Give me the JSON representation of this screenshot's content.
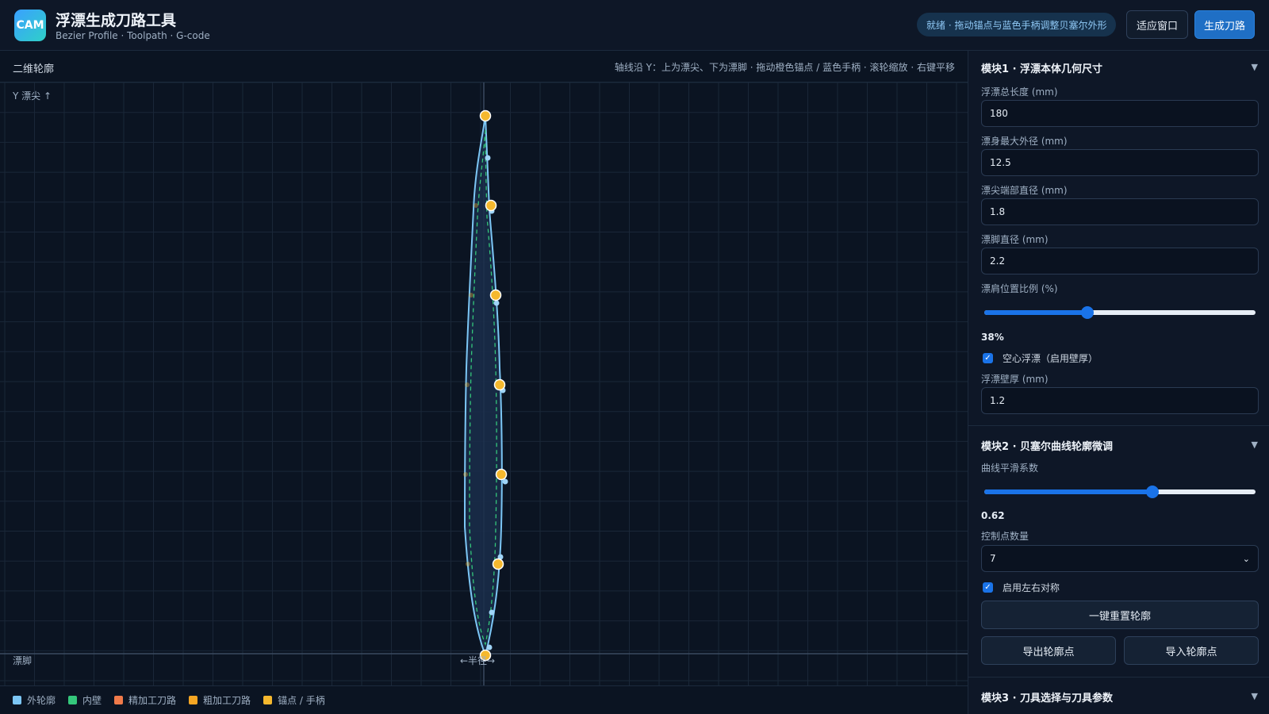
{
  "header": {
    "logo": "CAM",
    "title": "浮漂生成刀路工具",
    "subtitle": "Bezier Profile · Toolpath · G-code",
    "status": "就绪 · 拖动锚点与蓝色手柄调整贝塞尔外形",
    "fit_button": "适应窗口",
    "generate_button": "生成刀路"
  },
  "canvas": {
    "title": "二维轮廓",
    "hint": "轴线沿 Y：上为漂尖、下为漂脚 · 拖动橙色锚点 / 蓝色手柄 · 滚轮缩放 · 右键平移",
    "label_top": "Y 漂尖 ↑",
    "label_bottom": "漂脚",
    "label_radius": "←半径→"
  },
  "legend": [
    {
      "label": "外轮廓",
      "color": "#7cc6f5"
    },
    {
      "label": "内壁",
      "color": "#34c77b"
    },
    {
      "label": "精加工刀路",
      "color": "#f07a4a"
    },
    {
      "label": "粗加工刀路",
      "color": "#f5a623"
    },
    {
      "label": "锚点 / 手柄",
      "color": "#f5b82e"
    }
  ],
  "colors": {
    "outer_profile": "#7cc6f5",
    "inner_wall": "#34c77b",
    "anchor": "#f5b82e",
    "handle": "#9fd4f7",
    "accent": "#1f6fc5"
  },
  "module1": {
    "title": "模块1 · 浮漂本体几何尺寸",
    "length_label": "浮漂总长度 (mm)",
    "length_value": "180",
    "max_dia_label": "漂身最大外径 (mm)",
    "max_dia_value": "12.5",
    "tip_dia_label": "漂尖端部直径 (mm)",
    "tip_dia_value": "1.8",
    "foot_dia_label": "漂脚直径 (mm)",
    "foot_dia_value": "2.2",
    "shoulder_label": "漂肩位置比例 (%)",
    "shoulder_value": "38%",
    "shoulder_fraction": 0.38,
    "hollow_label": "空心浮漂（启用壁厚）",
    "hollow_checked": true,
    "wall_label": "浮漂壁厚 (mm)",
    "wall_value": "1.2"
  },
  "module2": {
    "title": "模块2 · 贝塞尔曲线轮廓微调",
    "smooth_label": "曲线平滑系数",
    "smooth_value": "0.62",
    "smooth_fraction": 0.62,
    "ctrl_label": "控制点数量",
    "ctrl_value": "7",
    "symmetry_label": "启用左右对称",
    "symmetry_checked": true,
    "reset_button": "一键重置轮廓",
    "export_button": "导出轮廓点",
    "import_button": "导入轮廓点"
  },
  "module3": {
    "title": "模块3 · 刀具选择与刀具参数"
  }
}
